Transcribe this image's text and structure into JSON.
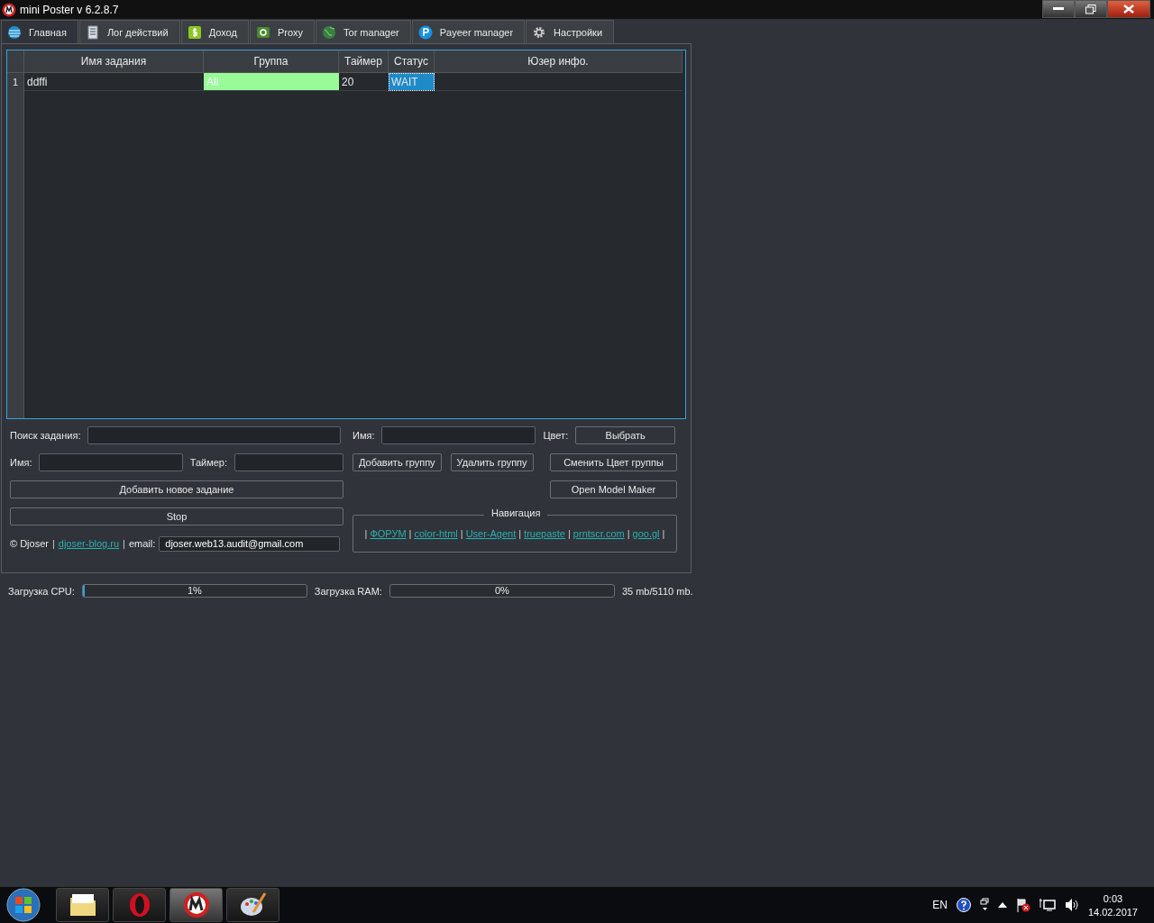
{
  "window": {
    "title": "mini Poster v 6.2.8.7"
  },
  "tabs": [
    {
      "label": "Главная",
      "selected": true
    },
    {
      "label": "Лог действий",
      "selected": false
    },
    {
      "label": "Доход",
      "selected": false
    },
    {
      "label": "Proxy",
      "selected": false
    },
    {
      "label": "Tor manager",
      "selected": false
    },
    {
      "label": "Payeer manager",
      "selected": false
    },
    {
      "label": "Настройки",
      "selected": false
    }
  ],
  "table": {
    "columns": [
      "Имя задания",
      "Группа",
      "Таймер",
      "Статус",
      "Юзер инфо."
    ],
    "rows": [
      {
        "number": "1",
        "cells": [
          {
            "text": "ddffi",
            "selected": false
          },
          {
            "text": "All",
            "selected": false,
            "color": "#98fb98"
          },
          {
            "text": "20",
            "selected": false
          },
          {
            "text": "WAIT",
            "selected": true
          }
        ]
      }
    ]
  },
  "form": {
    "search_label": "Поиск задания:",
    "name_label": "Имя:",
    "timer_label": "Таймер:",
    "add_task": "Добавить новое задание",
    "stop": "Stop",
    "group_name_label": "Имя:",
    "color_label": "Цвет:",
    "choose": "Выбрать",
    "add_group": "Добавить группу",
    "delete_group": "Удалить группу",
    "change_color": "Сменить Цвет группы",
    "model_maker": "Open Model Maker",
    "footer": [
      {
        "kind": "text",
        "text": "© Djoser"
      },
      {
        "kind": "separator",
        "text": "|"
      },
      {
        "kind": "link",
        "text": "djoser-blog.ru"
      },
      {
        "kind": "separator",
        "text": "|"
      },
      {
        "kind": "text",
        "text": "email:"
      }
    ],
    "email": "djoser.web13.audit@gmail.com"
  },
  "navigation": {
    "title": "Навигация",
    "items": [
      {
        "kind": "separator",
        "text": "|"
      },
      {
        "kind": "link",
        "text": "ФОРУМ"
      },
      {
        "kind": "separator",
        "text": "|"
      },
      {
        "kind": "link",
        "text": "color-html"
      },
      {
        "kind": "separator",
        "text": "|"
      },
      {
        "kind": "link",
        "text": "User-Agent"
      },
      {
        "kind": "separator",
        "text": "|"
      },
      {
        "kind": "link",
        "text": "truepaste"
      },
      {
        "kind": "separator",
        "text": "|"
      },
      {
        "kind": "link",
        "text": "prntscr.com"
      },
      {
        "kind": "separator",
        "text": "|"
      },
      {
        "kind": "link",
        "text": "goo.gl"
      },
      {
        "kind": "separator",
        "text": "|"
      }
    ]
  },
  "status": {
    "cpu": {
      "label": "Загрузка CPU:",
      "level": 0.01,
      "reading": "1%"
    },
    "ram": {
      "label": "Загрузка RAM:",
      "level": 0,
      "reading": "0%"
    },
    "memory": "35 mb/5110 mb."
  },
  "taskbar": {
    "apps": [
      {
        "active": false
      },
      {
        "active": false
      },
      {
        "active": true
      },
      {
        "active": false
      }
    ],
    "language": "EN",
    "time": "0:03",
    "date": "14.02.2017"
  }
}
